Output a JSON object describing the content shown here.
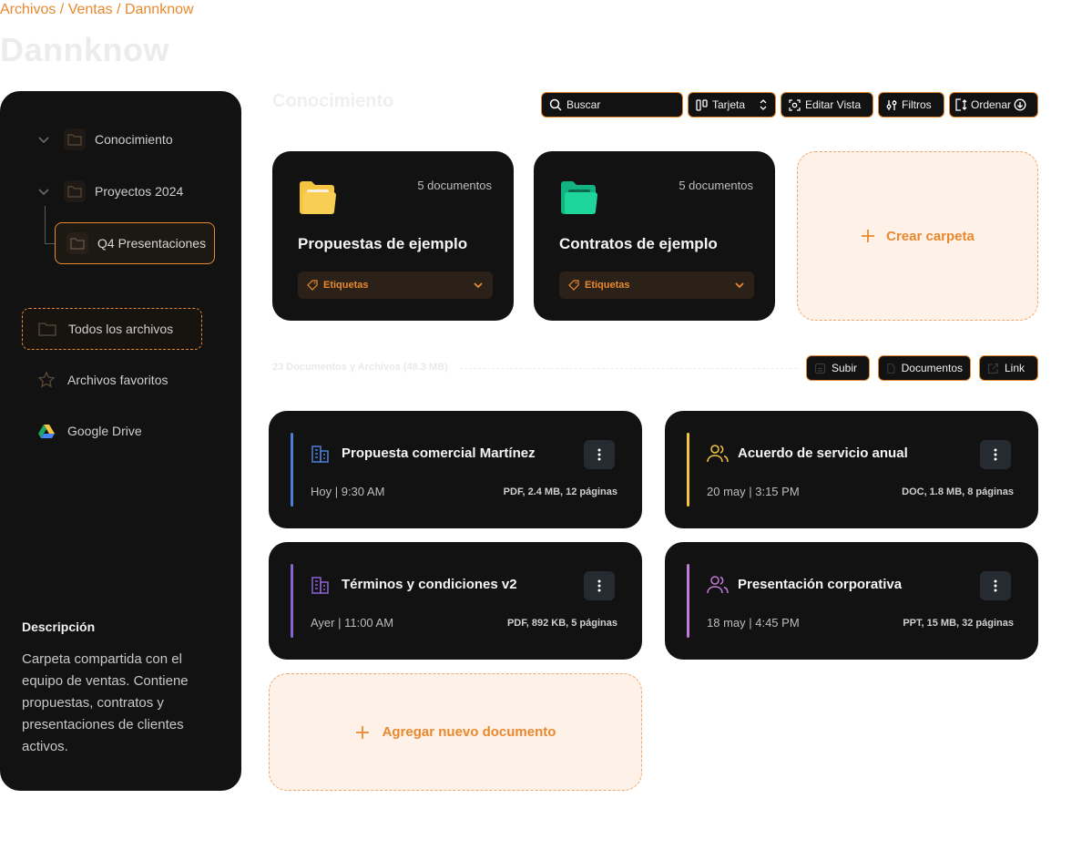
{
  "breadcrumb": "Archivos / Ventas / Dannknow",
  "page_title": "Dannknow",
  "sidebar": {
    "tree": [
      {
        "label": "Conocimiento"
      },
      {
        "label": "Proyectos 2024"
      },
      {
        "label": "Q4 Presentaciones"
      }
    ],
    "nav": [
      {
        "label": "Todos los archivos",
        "icon": "folder-icon"
      },
      {
        "label": "Archivos favoritos",
        "icon": "star-icon"
      },
      {
        "label": "Google Drive",
        "icon": "google-drive-icon"
      }
    ],
    "description_title": "Descripción",
    "description_text": "Carpeta compartida con el equipo de ventas. Contiene propuestas, contratos y presentaciones de clientes activos."
  },
  "main": {
    "section_title": "Conocimiento",
    "toolbar": {
      "search_placeholder": "Buscar",
      "view_label": "Tarjeta",
      "edit_view_label": "Editar Vista",
      "filters_label": "Filtros",
      "sort_label": "Ordenar"
    },
    "folders": [
      {
        "name": "Propuestas de ejemplo",
        "count": "5 documentos",
        "tags_label": "Etiquetas",
        "color": "#f5c542"
      },
      {
        "name": "Contratos de ejemplo",
        "count": "5 documentos",
        "tags_label": "Etiquetas",
        "color": "#1fd69a"
      }
    ],
    "create_folder_label": "Crear carpeta",
    "summary": "23 Documentos y Archivos (48.3 MB)",
    "actions": {
      "upload": "Subir",
      "documents": "Documentos",
      "link": "Link"
    },
    "documents": [
      {
        "title": "Propuesta comercial Martínez",
        "date": "Hoy | 9:30 AM",
        "meta": "PDF, 2.4 MB, 12 páginas",
        "accent": "#4a7fd8",
        "icon": "building-icon"
      },
      {
        "title": "Acuerdo de servicio anual",
        "date": "20 may | 3:15 PM",
        "meta": "DOC, 1.8 MB, 8 páginas",
        "accent": "#f5c542",
        "icon": "users-icon"
      },
      {
        "title": "Términos y condiciones v2",
        "date": "Ayer | 11:00 AM",
        "meta": "PDF, 892 KB, 5 páginas",
        "accent": "#8a63d2",
        "icon": "building-icon"
      },
      {
        "title": "Presentación corporativa",
        "date": "18 may | 4:45 PM",
        "meta": "PPT, 15 MB, 32 páginas",
        "accent": "#c47ad9",
        "icon": "users-icon"
      }
    ],
    "add_document_label": "Agregar nuevo documento"
  }
}
